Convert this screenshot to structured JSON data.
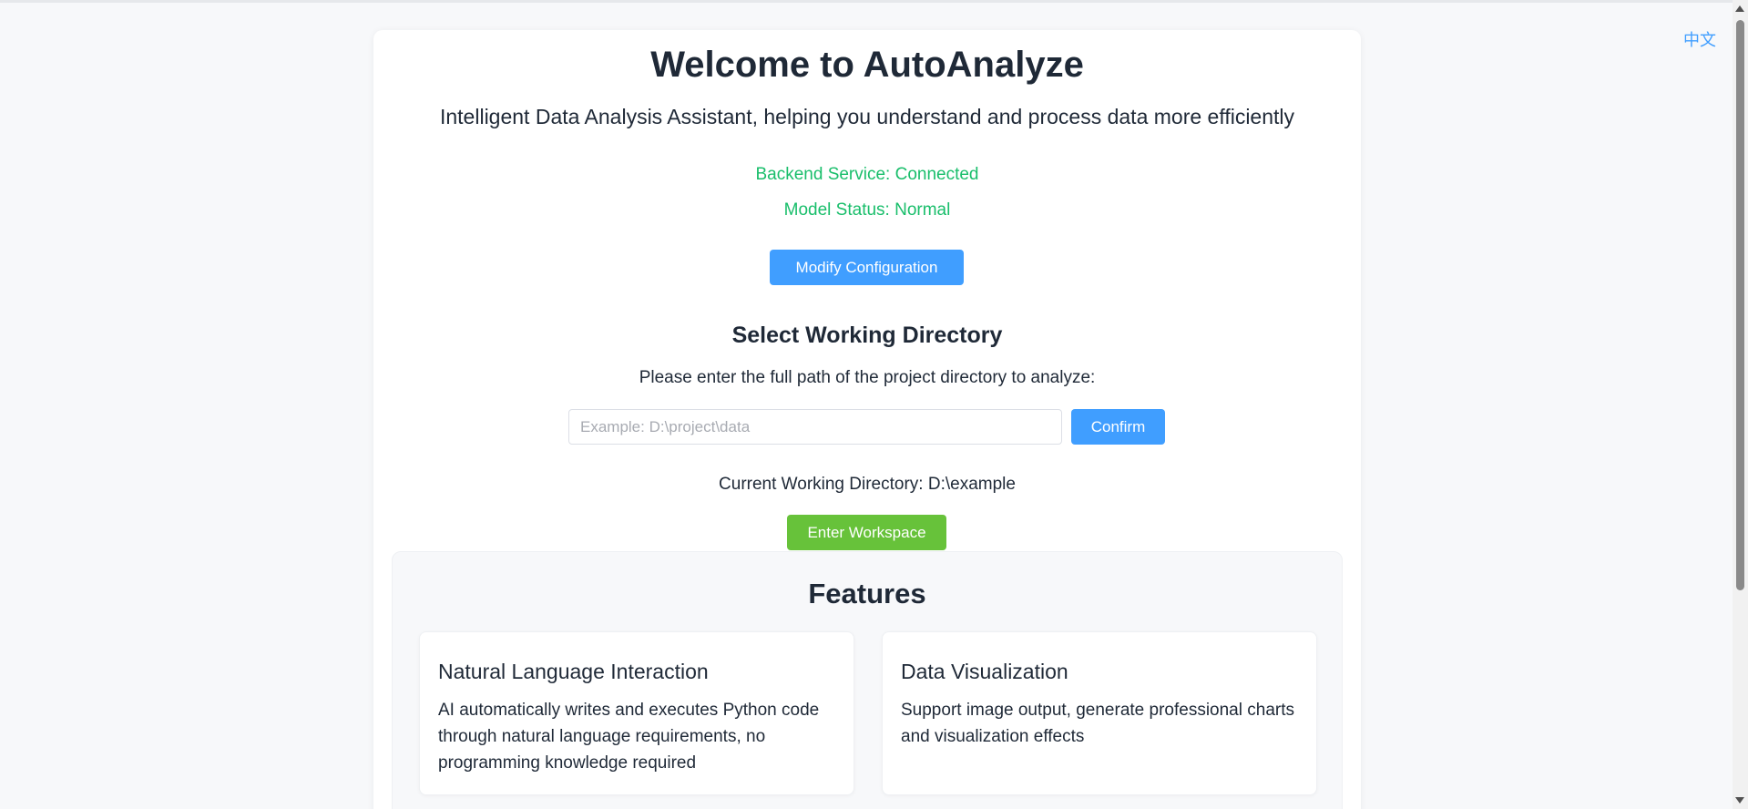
{
  "language_switch": "中文",
  "header": {
    "title": "Welcome to AutoAnalyze",
    "subtitle": "Intelligent Data Analysis Assistant, helping you understand and process data more efficiently"
  },
  "status": {
    "backend": "Backend Service: Connected",
    "model": "Model Status: Normal",
    "color": "#19be6b"
  },
  "config_button": "Modify Configuration",
  "directory": {
    "title": "Select Working Directory",
    "instruction": "Please enter the full path of the project directory to analyze:",
    "input_value": "",
    "placeholder": "Example: D:\\project\\data",
    "confirm_label": "Confirm",
    "current": "Current Working Directory: D:\\example",
    "enter_label": "Enter Workspace"
  },
  "features": {
    "title": "Features",
    "items": [
      {
        "title": "Natural Language Interaction",
        "description": "AI automatically writes and executes Python code through natural language requirements, no programming knowledge required"
      },
      {
        "title": "Data Visualization",
        "description": "Support image output, generate professional charts and visualization effects"
      }
    ]
  },
  "colors": {
    "primary": "#409eff",
    "success": "#67c23a",
    "status": "#19be6b"
  }
}
